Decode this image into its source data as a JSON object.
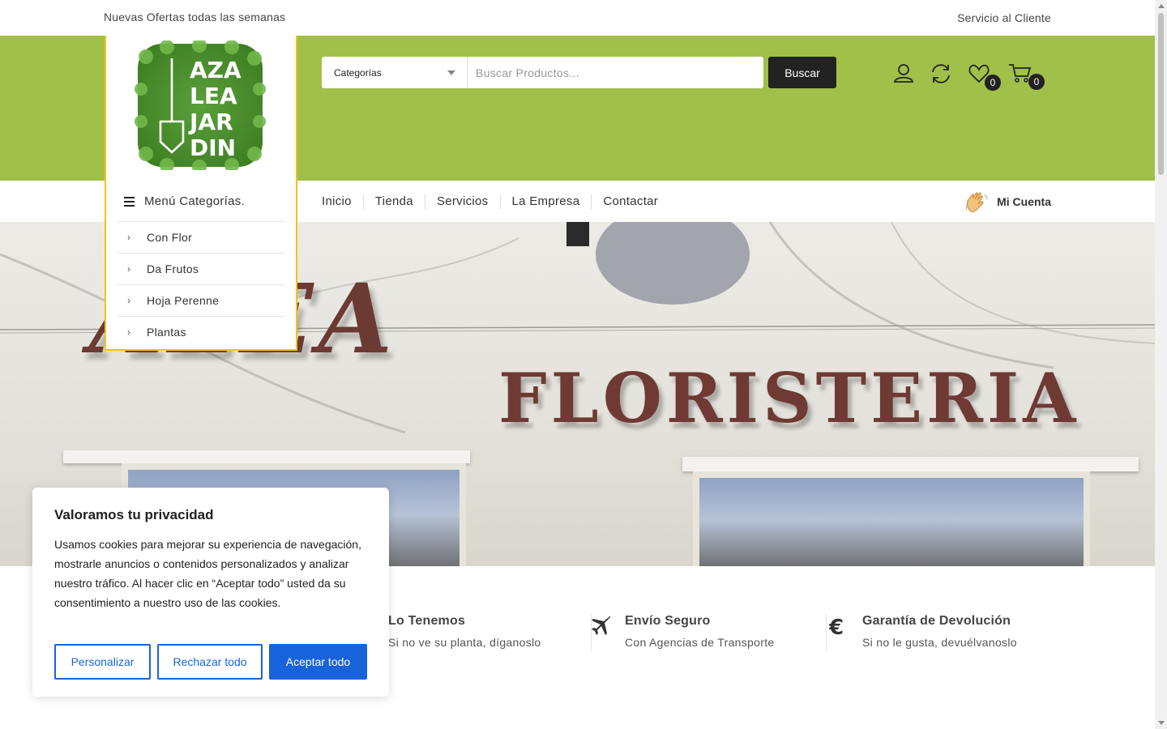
{
  "topbar": {
    "promo": "Nuevas Ofertas todas las semanas",
    "service": "Servicio al Cliente"
  },
  "logo": {
    "lines": [
      "AZA",
      "LEA",
      "JAR",
      "DIN"
    ]
  },
  "search": {
    "category": "Categorías",
    "placeholder": "Buscar Productos...",
    "button": "Buscar"
  },
  "header_icons": {
    "wishlist_count": "0",
    "cart_count": "0"
  },
  "categories": {
    "title": "Menú Categorías.",
    "items": [
      "Con Flor",
      "Da Frutos",
      "Hoja Perenne",
      "Plantas"
    ]
  },
  "nav": {
    "links": [
      "Inicio",
      "Tienda",
      "Servicios",
      "La Empresa",
      "Contactar"
    ],
    "account": "Mi Cuenta"
  },
  "hero": {
    "sign_top": "ALEA",
    "sign_bottom": "FLORISTERIA"
  },
  "features": [
    {
      "icon": "clock-icon",
      "title": "Lo Tenemos",
      "subtitle": "Si no ve su planta, díganoslo"
    },
    {
      "icon": "airplane-icon",
      "title": "Envío Seguro",
      "subtitle": "Con Agencias de Transporte"
    },
    {
      "icon": "euro-icon",
      "title": "Garantía de Devolución",
      "subtitle": "Si no le gusta, devuélvanoslo"
    }
  ],
  "cookie": {
    "title": "Valoramos tu privacidad",
    "text": "Usamos cookies para mejorar su experiencia de navegación, mostrarle anuncios o contenidos personalizados y analizar nuestro tráfico. Al hacer clic en “Aceptar todo” usted da su consentimiento a nuestro uso de las cookies.",
    "customize": "Personalizar",
    "reject": "Rechazar todo",
    "accept": "Aceptar todo"
  },
  "colors": {
    "header_green": "#a0c04a",
    "accent_yellow": "#f0c419",
    "cookie_blue": "#1863dc",
    "sign_brown": "#6b3a32"
  }
}
